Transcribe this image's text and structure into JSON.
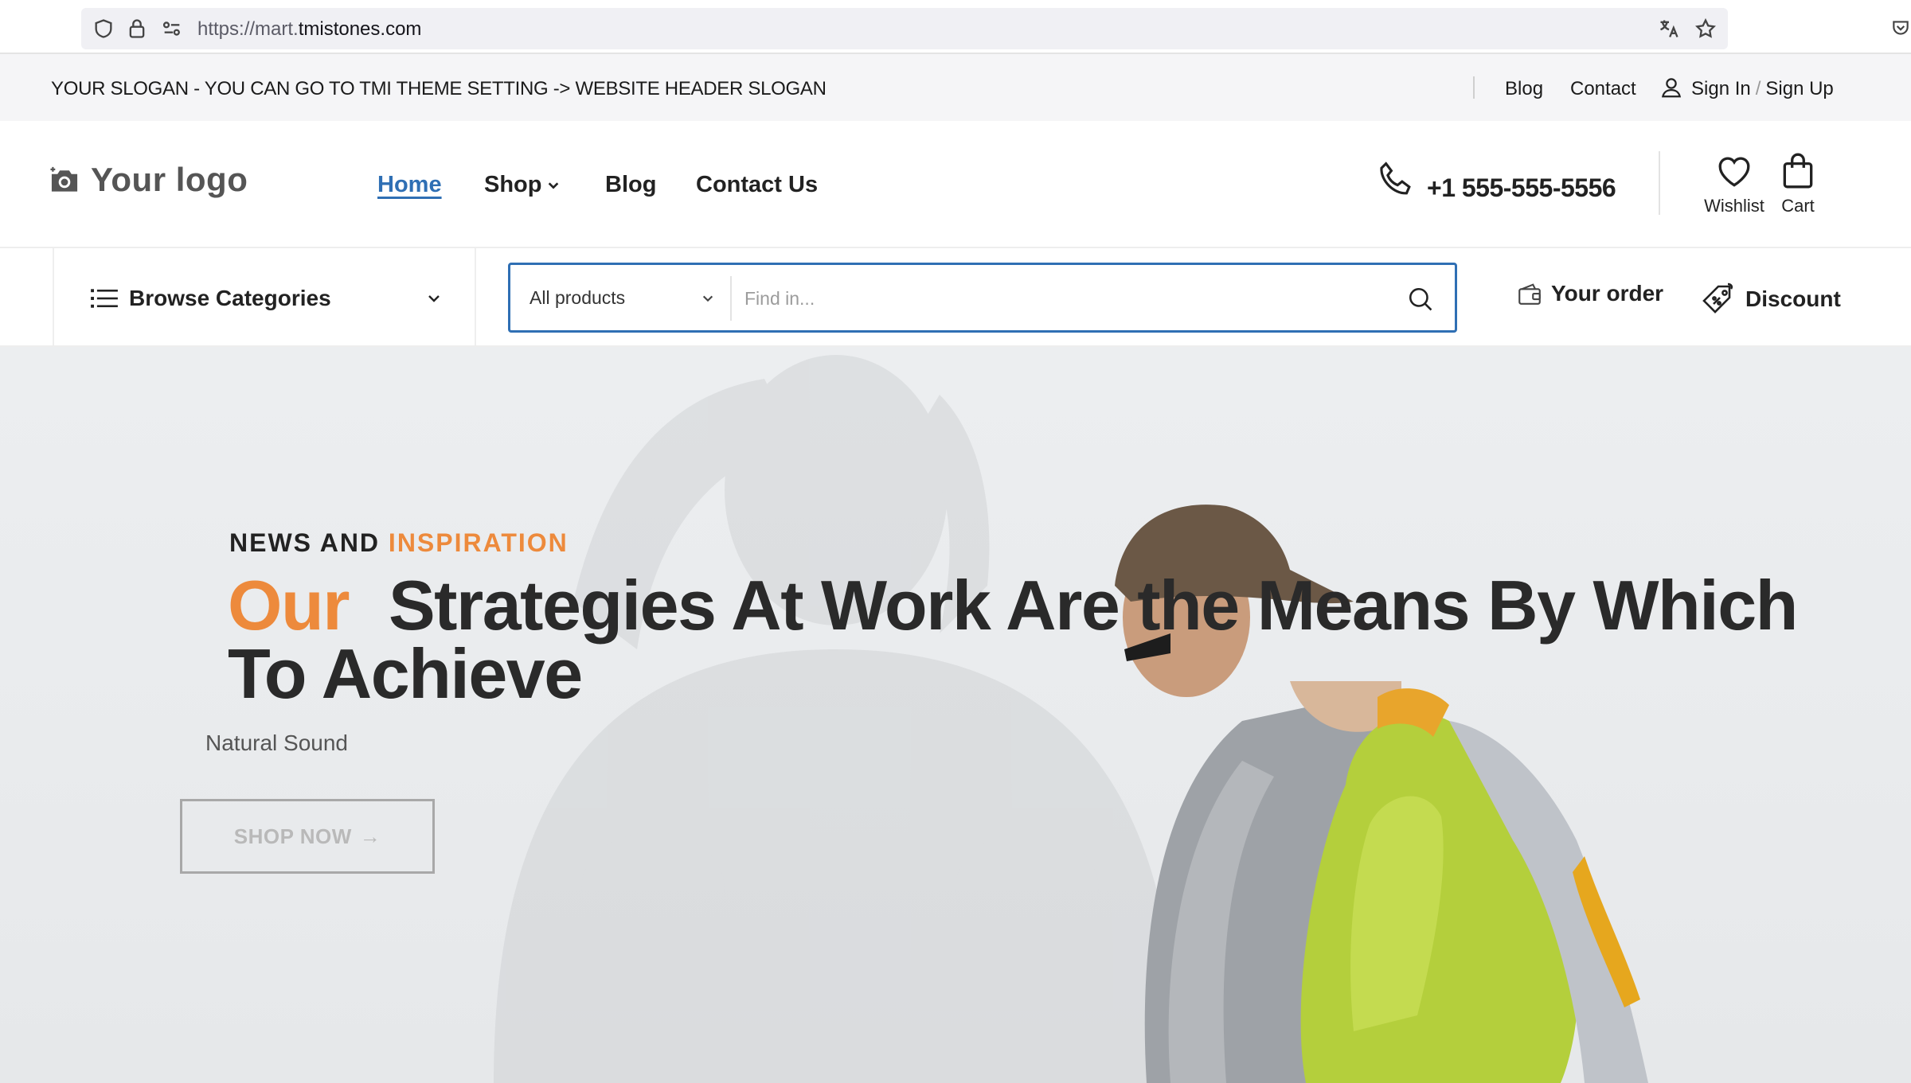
{
  "browser": {
    "url_prefix": "https://mart.",
    "url_domain": "tmistones.com"
  },
  "topbar": {
    "slogan": "YOUR SLOGAN - YOU CAN GO TO TMI THEME SETTING -> WEBSITE HEADER SLOGAN",
    "links": {
      "blog": "Blog",
      "contact": "Contact"
    },
    "sign_in": "Sign In",
    "separator": "/",
    "sign_up": "Sign Up"
  },
  "header": {
    "logo_text": "Your logo",
    "nav": {
      "home": "Home",
      "shop": "Shop",
      "blog": "Blog",
      "contact": "Contact Us"
    },
    "phone": "+1 555-555-5556",
    "wishlist_label": "Wishlist",
    "cart_label": "Cart"
  },
  "catbar": {
    "browse_label": "Browse Categories",
    "search_category": "All products",
    "search_placeholder": "Find in...",
    "your_order": "Your order",
    "discount": "Discount"
  },
  "hero": {
    "kicker_main": "NEWS AND",
    "kicker_accent": "INSPIRATION",
    "title_accent": "Our",
    "title_rest": "Strategies At Work Are the Means By Which To Achieve",
    "subtitle": "Natural Sound",
    "cta": "SHOP NOW",
    "cta_arrow": "→"
  },
  "colors": {
    "accent_orange": "#ed8a3c",
    "link_blue": "#2f6fb4",
    "text_dark": "#222222"
  }
}
